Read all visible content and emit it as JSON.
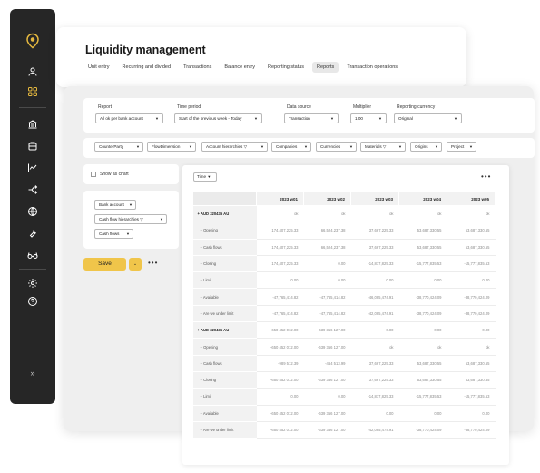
{
  "sidebar": {
    "icons": [
      "location-pin-logo-icon",
      "user-icon",
      "grid-icon",
      "bank-icon",
      "box-icon",
      "chart-line-icon",
      "split-arrows-icon",
      "globe-icon",
      "wrench-icon",
      "glasses-icon",
      "gear-icon",
      "help-icon"
    ],
    "expand_label": "»",
    "accent": "#e6b93f"
  },
  "header": {
    "title": "Liquidity management",
    "tabs": [
      "Unit entry",
      "Recurring and divided",
      "Transactions",
      "Balance entry",
      "Reporting status",
      "Reports",
      "Transaction operations"
    ],
    "active_tab": "Reports"
  },
  "filters": {
    "report": {
      "label": "Report",
      "value": "All ok per bank account"
    },
    "time_period": {
      "label": "Time period",
      "value": "Start of the previous week - Today"
    },
    "data_source": {
      "label": "Data source",
      "value": "Transaction"
    },
    "multiplier": {
      "label": "Multiplier",
      "value": "1,00"
    },
    "reporting_currency": {
      "label": "Reporting currency",
      "value": "Original"
    }
  },
  "dimension_chips": [
    "CounterParty",
    "FlowDimension",
    "Account hierarchies",
    "Companies",
    "Currencies",
    "Materials",
    "Origins",
    "Project"
  ],
  "show_as_chart": "Show as chart",
  "row_dims": [
    "Bank account",
    "Cash flow hierarchies",
    "Cash flows"
  ],
  "save": {
    "label": "Save"
  },
  "time_pill": "Time",
  "table": {
    "columns": [
      "2023 w01",
      "2023 w02",
      "2023 w03",
      "2023 w04",
      "2023 w05"
    ],
    "rows": [
      {
        "label": "+ AUD 320435 AU",
        "group": true,
        "values": [
          "ok",
          "ok",
          "ok",
          "ok",
          "ok"
        ]
      },
      {
        "label": "+ Opening",
        "values": [
          "174,407,225.33",
          "66,524,237.38",
          "37,667,225.33",
          "53,687,330.55",
          "53,687,330.55"
        ]
      },
      {
        "label": "+ Cash flows",
        "values": [
          "174,407,225.33",
          "66,524,237.38",
          "37,667,225.33",
          "53,687,330.55",
          "53,687,330.55"
        ]
      },
      {
        "label": "+ Closing",
        "values": [
          "174,407,225.33",
          "0.00",
          "-14,817,825.33",
          "-15,777,835.53",
          "-15,777,835.53"
        ]
      },
      {
        "label": "+ Limit",
        "values": [
          "0.00",
          "0.00",
          "0.00",
          "0.00",
          "0.00"
        ]
      },
      {
        "label": "+ Available",
        "values": [
          "-47,765,414.82",
          "-47,765,414.82",
          "-46,085,474.91",
          "-38,770,424.09",
          "-38,770,424.09"
        ]
      },
      {
        "label": "+ Are we under limit",
        "values": [
          "-47,765,414.82",
          "-47,765,414.82",
          "-42,085,474.91",
          "-38,770,424.09",
          "-38,770,424.09"
        ]
      },
      {
        "label": "+ AUD 320435 AU",
        "group": true,
        "values": [
          "-650 452 012.00",
          "-639 356 127.00",
          "0.00",
          "0.00",
          "0.00"
        ]
      },
      {
        "label": "+ Opening",
        "values": [
          "-650 452 012.00",
          "-639 356 127.00",
          "ok",
          "ok",
          "ok"
        ]
      },
      {
        "label": "+ Cash flows",
        "values": [
          "-989 512.39",
          "-464 513.99",
          "37,667,225.33",
          "53,687,330.55",
          "53,687,330.55"
        ]
      },
      {
        "label": "+ Closing",
        "values": [
          "-650 452 012.00",
          "-639 356 127.00",
          "37,667,225.33",
          "53,687,330.55",
          "53,687,330.55"
        ]
      },
      {
        "label": "+ Limit",
        "values": [
          "0.00",
          "0.00",
          "-14,817,825.33",
          "-15,777,835.53",
          "-15,777,835.53"
        ]
      },
      {
        "label": "+ Available",
        "values": [
          "-650 452 012.00",
          "-639 356 127.00",
          "0.00",
          "0.00",
          "0.00"
        ]
      },
      {
        "label": "+ Are we under limit",
        "values": [
          "-650 452 012.00",
          "-639 356 127.00",
          "-42,085,474.91",
          "-38,770,424.09",
          "-38,770,424.09"
        ]
      }
    ]
  }
}
